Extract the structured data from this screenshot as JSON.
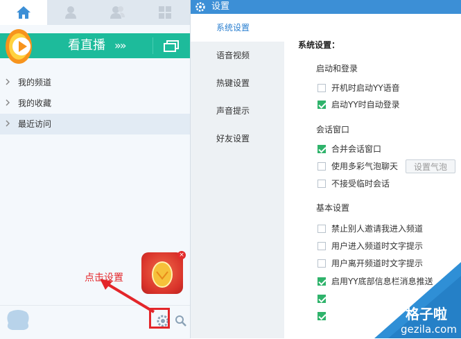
{
  "left_panel": {
    "tabs": [
      "home-icon",
      "user-icon",
      "contacts-icon",
      "apps-icon"
    ],
    "live_bar": {
      "title": "看直播",
      "chevron": "»»"
    },
    "nav": [
      {
        "label": "我的频道"
      },
      {
        "label": "我的收藏"
      },
      {
        "label": "最近访问"
      }
    ],
    "annotation": "点击设置",
    "egg_close": "×"
  },
  "settings": {
    "title": "设置",
    "sidebar": [
      "系统设置",
      "语音视频",
      "热键设置",
      "声音提示",
      "好友设置"
    ],
    "section_title": "系统设置：",
    "groups": {
      "startup": "启动和登录",
      "session": "会话窗口",
      "basic": "基本设置"
    },
    "options": [
      {
        "label": "开机时启动YY语音",
        "checked": false
      },
      {
        "label": "启动YY时自动登录",
        "checked": true
      },
      {
        "label": "合并会话窗口",
        "checked": true
      },
      {
        "label": "使用多彩气泡聊天",
        "checked": false
      },
      {
        "label": "不接受临时会话",
        "checked": false
      },
      {
        "label": "禁止别人邀请我进入频道",
        "checked": false
      },
      {
        "label": "用户进入频道时文字提示",
        "checked": false
      },
      {
        "label": "用户离开频道时文字提示",
        "checked": false
      },
      {
        "label": "启用YY底部信息栏消息推送",
        "checked": true
      },
      {
        "label": "",
        "checked": true
      },
      {
        "label": "",
        "checked": true
      }
    ],
    "bubble_button": "设置气泡"
  },
  "watermark": {
    "line1": "格子啦",
    "line2": "gezila.com"
  },
  "colors": {
    "accent": "#3c8fd6",
    "live": "#1dbb9b",
    "check": "#2fb36b",
    "annot": "#e3262a"
  }
}
